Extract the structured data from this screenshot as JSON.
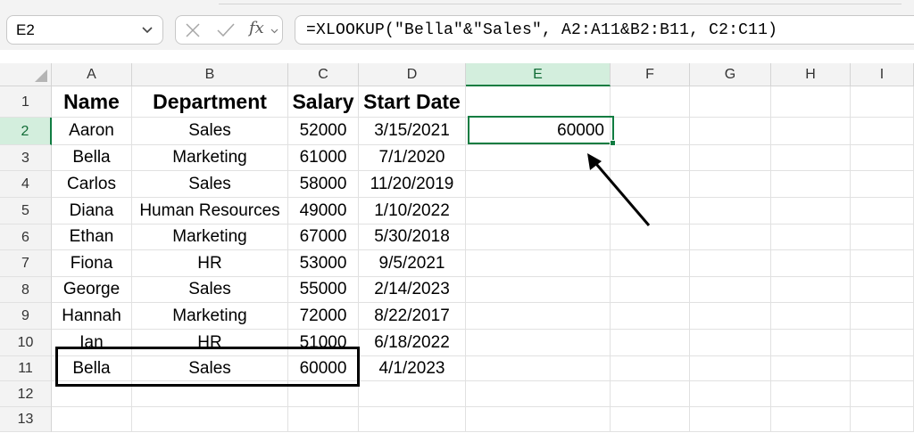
{
  "name_box": {
    "value": "E2"
  },
  "formula_bar": {
    "fx_label": "fx",
    "formula": "=XLOOKUP(\"Bella\"&\"Sales\", A2:A11&B2:B11, C2:C11)"
  },
  "columns": [
    "A",
    "B",
    "C",
    "D",
    "E",
    "F",
    "G",
    "H",
    "I"
  ],
  "rows": [
    "1",
    "2",
    "3",
    "4",
    "5",
    "6",
    "7",
    "8",
    "9",
    "10",
    "11",
    "12",
    "13"
  ],
  "selected_cell": {
    "column": "E",
    "row": "2",
    "value": "60000"
  },
  "table": {
    "headers": [
      "Name",
      "Department",
      "Salary",
      "Start Date"
    ],
    "rows": [
      [
        "Aaron",
        "Sales",
        "52000",
        "3/15/2021"
      ],
      [
        "Bella",
        "Marketing",
        "61000",
        "7/1/2020"
      ],
      [
        "Carlos",
        "Sales",
        "58000",
        "11/20/2019"
      ],
      [
        "Diana",
        "Human Resources",
        "49000",
        "1/10/2022"
      ],
      [
        "Ethan",
        "Marketing",
        "67000",
        "5/30/2018"
      ],
      [
        "Fiona",
        "HR",
        "53000",
        "9/5/2021"
      ],
      [
        "George",
        "Sales",
        "55000",
        "2/14/2023"
      ],
      [
        "Hannah",
        "Marketing",
        "72000",
        "8/22/2017"
      ],
      [
        "Ian",
        "HR",
        "51000",
        "6/18/2022"
      ],
      [
        "Bella",
        "Sales",
        "60000",
        "4/1/2023"
      ]
    ]
  },
  "colors": {
    "selection_accent": "#107c41",
    "header_selected_bg": "#d3eedd",
    "annotation": "#000000"
  },
  "icons": {
    "name_box_dropdown": "chevron-down-icon",
    "cancel": "x-icon",
    "enter": "checkmark-icon",
    "insert_function": "fx-icon",
    "formula_dropdown": "chevron-down-icon"
  }
}
